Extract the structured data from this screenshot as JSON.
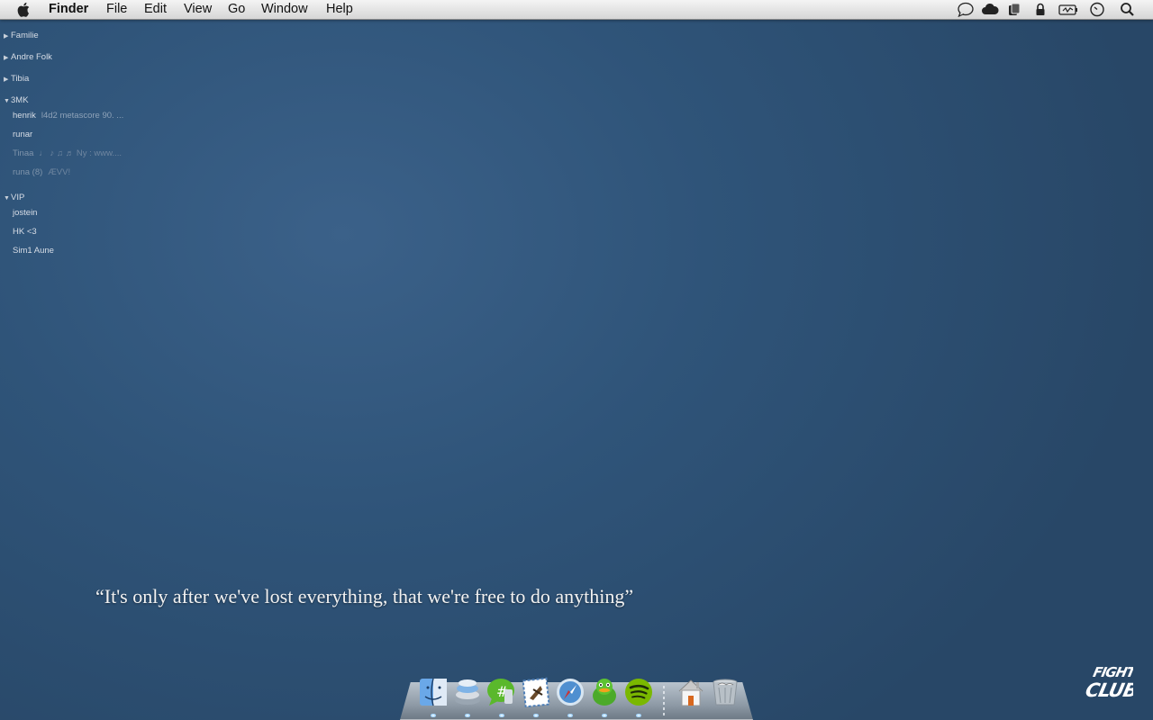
{
  "menubar": {
    "app_name": "Finder",
    "items": [
      "File",
      "Edit",
      "View",
      "Go",
      "Window",
      "Help"
    ],
    "status_icons": [
      "chat-bubble-icon",
      "cloud-icon",
      "dropbox-icon",
      "lock-icon",
      "battery-icon",
      "clock-icon",
      "spotlight-search-icon"
    ]
  },
  "buddy_list": {
    "groups": [
      {
        "name": "Familie",
        "expanded": false
      },
      {
        "name": "Andre Folk",
        "expanded": false
      },
      {
        "name": "Tibia",
        "expanded": false
      },
      {
        "name": "3MK",
        "expanded": true,
        "buddies": [
          {
            "name": "henrik",
            "status": "l4d2 metascore 90. ...",
            "away": false
          },
          {
            "name": "runar",
            "status": "",
            "away": false
          },
          {
            "name": "Tinaa",
            "status": "♩ ♪ ♫ ♬  Ny : www....",
            "away": true
          },
          {
            "name": "runa (8)",
            "status": "ÆVV!",
            "away": true
          }
        ]
      },
      {
        "name": "VIP",
        "expanded": true,
        "buddies": [
          {
            "name": "jostein",
            "status": "",
            "away": false
          },
          {
            "name": "HK <3",
            "status": "",
            "away": false
          },
          {
            "name": "Sim1 Aune",
            "status": "",
            "away": false
          }
        ]
      }
    ]
  },
  "quote": "“It's only after we've lost everything, that we're free to do anything”",
  "dock": {
    "apps": [
      "finder-icon",
      "adium-duck-icon",
      "messages-icon",
      "mail-icon",
      "safari-icon",
      "adium-icon",
      "spotify-icon"
    ],
    "others": [
      "home-folder-icon",
      "trash-icon"
    ]
  },
  "logo_text": "FIGHT CLUB",
  "colors": {
    "desktop": "#2f5479",
    "menubar": "#e6e6e6",
    "spotify": "#7ab800"
  }
}
